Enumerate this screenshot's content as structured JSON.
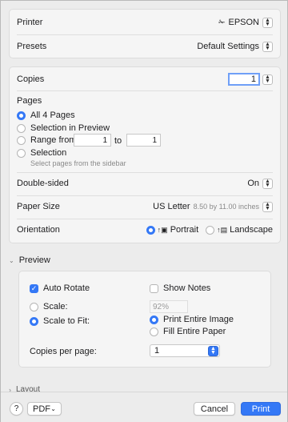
{
  "printer": {
    "label": "Printer",
    "value": "EPSON"
  },
  "presets": {
    "label": "Presets",
    "value": "Default Settings"
  },
  "copies": {
    "label": "Copies",
    "value": "1"
  },
  "pages": {
    "label": "Pages",
    "all": "All 4 Pages",
    "selection_preview": "Selection in Preview",
    "range_from": "Range from",
    "range_from_value": "1",
    "to": "to",
    "range_to_value": "1",
    "selection": "Selection",
    "selection_hint": "Select pages from the sidebar",
    "selected": "all"
  },
  "double_sided": {
    "label": "Double-sided",
    "value": "On"
  },
  "paper_size": {
    "label": "Paper Size",
    "value": "US Letter",
    "detail": "8.50 by 11.00 inches"
  },
  "orientation": {
    "label": "Orientation",
    "portrait": "Portrait",
    "landscape": "Landscape",
    "selected": "portrait"
  },
  "preview": {
    "title": "Preview",
    "auto_rotate": "Auto Rotate",
    "auto_rotate_checked": true,
    "show_notes": "Show Notes",
    "show_notes_checked": false,
    "scale": "Scale:",
    "scale_value": "92%",
    "scale_to_fit": "Scale to Fit:",
    "fit_mode": "scale_to_fit",
    "print_entire_image": "Print Entire Image",
    "fill_entire_paper": "Fill Entire Paper",
    "fit_option": "print_entire_image",
    "copies_per_page": "Copies per page:",
    "copies_per_page_value": "1"
  },
  "layout": {
    "title": "Layout"
  },
  "footer": {
    "help": "?",
    "pdf": "PDF",
    "cancel": "Cancel",
    "print": "Print"
  },
  "colors": {
    "accent": "#3478f6"
  }
}
